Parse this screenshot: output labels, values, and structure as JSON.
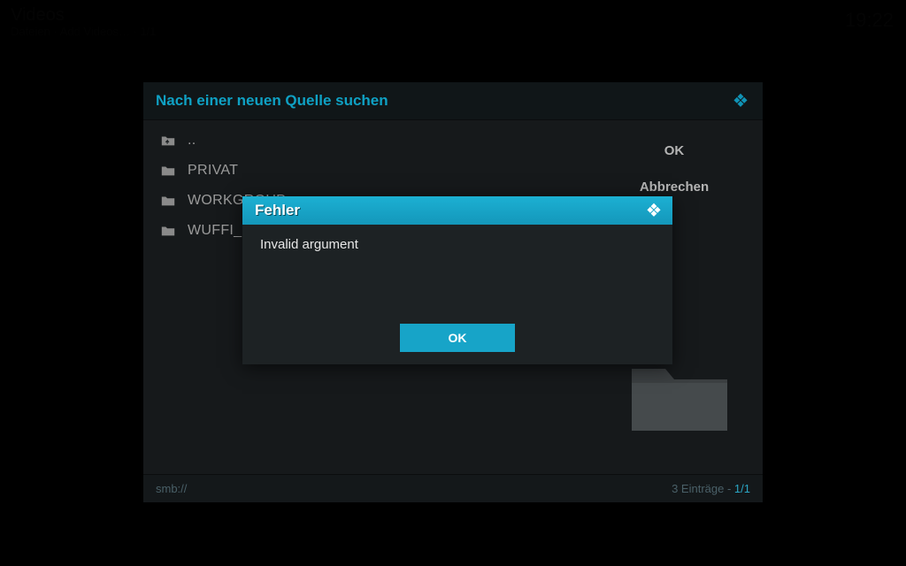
{
  "background": {
    "title": "Videos",
    "subtitle": "Dateien · Add Videos… · 1/1",
    "clock": "19:22"
  },
  "browse": {
    "title": "Nach einer neuen Quelle suchen",
    "items": [
      {
        "icon": "folder-up-icon",
        "label": ".."
      },
      {
        "icon": "folder-icon",
        "label": "PRIVAT"
      },
      {
        "icon": "folder-icon",
        "label": "WORKGROUP"
      },
      {
        "icon": "folder-icon",
        "label": "WUFFI_LAN"
      }
    ],
    "side": {
      "ok": "OK",
      "cancel": "Abbrechen"
    },
    "footer": {
      "path": "smb://",
      "count_prefix": "3 Einträge - ",
      "count_page": "1/1"
    }
  },
  "error": {
    "title": "Fehler",
    "message": "Invalid argument",
    "ok": "OK"
  },
  "colors": {
    "accent": "#17a4c8",
    "panel": "#16191b",
    "modal": "#1d2224"
  }
}
